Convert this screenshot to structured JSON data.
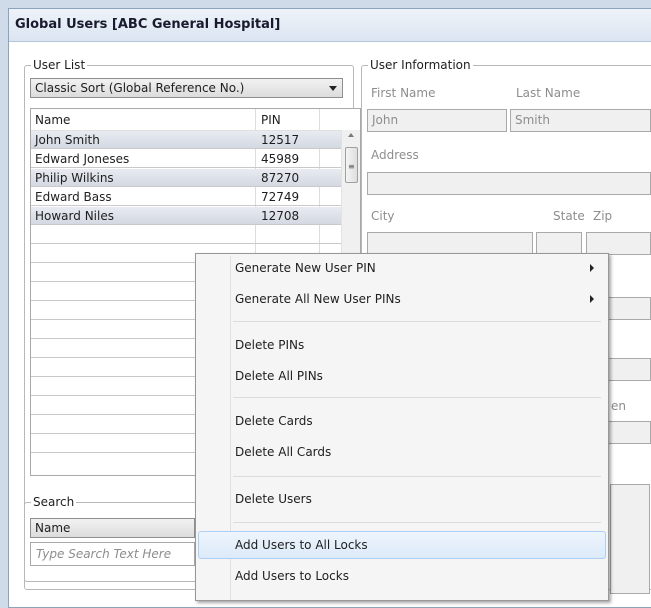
{
  "window": {
    "title": "Global Users [ABC General Hospital]"
  },
  "user_list": {
    "legend": "User List",
    "sort_selected": "Classic Sort (Global Reference No.)",
    "columns": {
      "name": "Name",
      "pin": "PIN"
    },
    "rows": [
      {
        "name": "John Smith",
        "pin": "12517"
      },
      {
        "name": "Edward Joneses",
        "pin": "45989"
      },
      {
        "name": "Philip Wilkins",
        "pin": "87270"
      },
      {
        "name": "Edward Bass",
        "pin": "72749"
      },
      {
        "name": "Howard Niles",
        "pin": "12708"
      }
    ]
  },
  "search": {
    "legend": "Search",
    "field_selected": "Name",
    "placeholder": "Type Search Text Here"
  },
  "user_info": {
    "legend": "User Information",
    "first_name_label": "First Name",
    "first_name_value": "John",
    "last_name_label": "Last Name",
    "last_name_value": "Smith",
    "address_label": "Address",
    "city_label": "City",
    "state_label": "State",
    "zip_label": "Zip",
    "partial_label": "en"
  },
  "context_menu": {
    "items": [
      {
        "label": "Generate New User PIN",
        "submenu": true
      },
      {
        "label": "Generate All New User PINs",
        "submenu": true
      },
      {
        "label": "Delete PINs"
      },
      {
        "label": "Delete All PINs"
      },
      {
        "label": "Delete Cards"
      },
      {
        "label": "Delete All Cards"
      },
      {
        "label": "Delete Users"
      },
      {
        "label": "Add Users to All Locks",
        "highlighted": true
      },
      {
        "label": "Add Users to Locks"
      }
    ]
  }
}
